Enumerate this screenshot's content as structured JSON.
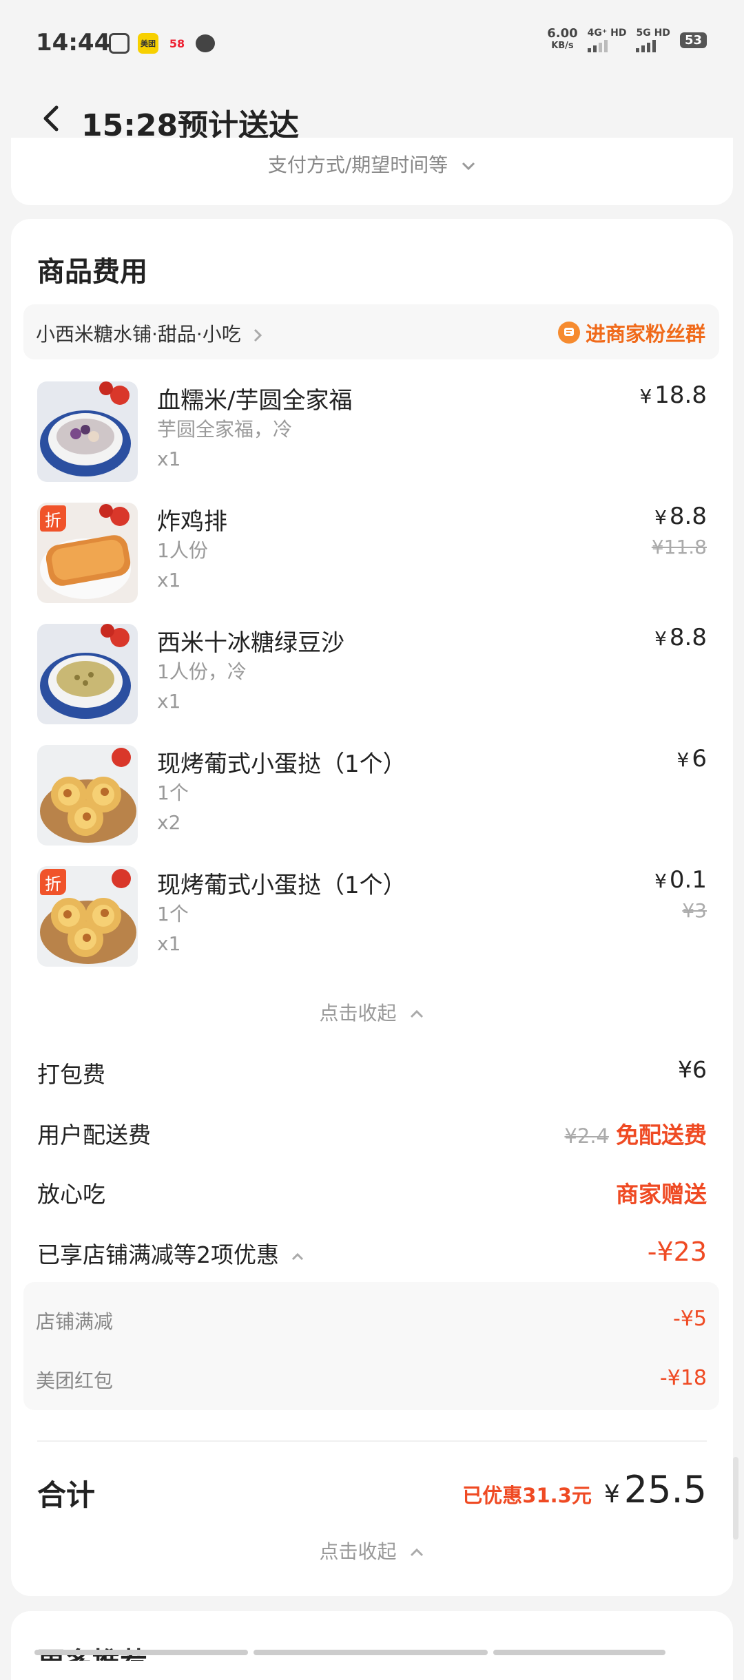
{
  "status_bar": {
    "time": "14:44",
    "app_icons": [
      "meituan-icon",
      "58-icon",
      "chat-bubble-icon",
      "screen-record-icon"
    ],
    "net_speed": "6.00",
    "net_speed_unit": "KB/s",
    "net_type_1": "4G⁺ HD",
    "net_type_2": "5G HD",
    "battery": "53"
  },
  "header": {
    "title": "15:28预计送达"
  },
  "payment": {
    "label": "支付方式/期望时间等"
  },
  "goods": {
    "section_title": "商品费用",
    "shop_name": "小西米糖水铺·甜品·小吃",
    "fans_label": "进商家粉丝群",
    "items": [
      {
        "name": "血糯米/芋圆全家福",
        "spec": "芋圆全家福，冷",
        "qty": "x1",
        "currency": "¥",
        "price": "18.8",
        "original_price": "",
        "tag": ""
      },
      {
        "name": "炸鸡排",
        "spec": "1人份",
        "qty": "x1",
        "currency": "¥",
        "price": "8.8",
        "original_price": "¥11.8",
        "tag": "折"
      },
      {
        "name": "西米十冰糖绿豆沙",
        "spec": "1人份，冷",
        "qty": "x1",
        "currency": "¥",
        "price": "8.8",
        "original_price": "",
        "tag": ""
      },
      {
        "name": "现烤葡式小蛋挞（1个）",
        "spec": "1个",
        "qty": "x2",
        "currency": "¥",
        "price": "6",
        "original_price": "",
        "tag": ""
      },
      {
        "name": "现烤葡式小蛋挞（1个）",
        "spec": "1个",
        "qty": "x1",
        "currency": "¥",
        "price": "0.1",
        "original_price": "¥3",
        "tag": "折"
      }
    ],
    "collapse_label": "点击收起"
  },
  "fees": {
    "packing": {
      "label": "打包费",
      "value": "¥6"
    },
    "delivery": {
      "label": "用户配送费",
      "original": "¥2.4",
      "value": "免配送费"
    },
    "safe_eat": {
      "label": "放心吃",
      "value": "商家赠送"
    },
    "discount_summary": {
      "label": "已享店铺满减等2项优惠",
      "value": "-¥23"
    }
  },
  "discounts": [
    {
      "label": "店铺满减",
      "value": "-¥5"
    },
    {
      "label": "美团红包",
      "value": "-¥18"
    }
  ],
  "total": {
    "label": "合计",
    "saved": "已优惠31.3元",
    "currency": "¥",
    "amount": "25.5",
    "collapse_label": "点击收起"
  },
  "next_section": {
    "title": "更多推荐"
  },
  "colors": {
    "accent_red": "#ef4a23",
    "accent_orange": "#f06a1a",
    "background": "#f4f4f4"
  }
}
